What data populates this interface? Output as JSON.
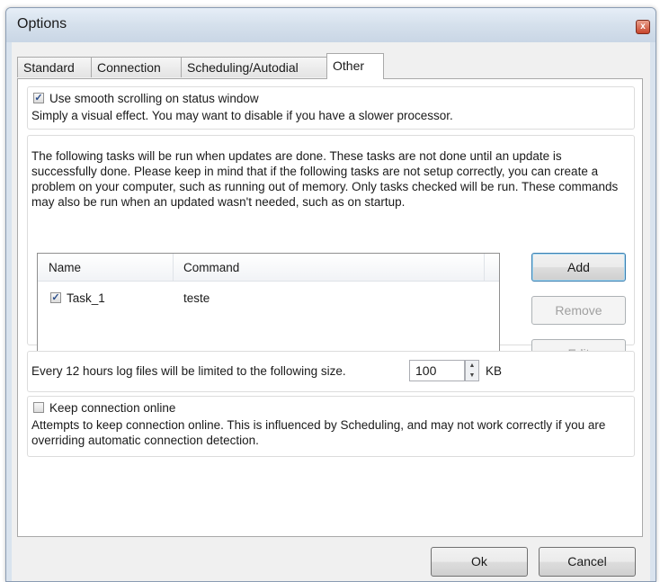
{
  "window": {
    "title": "Options",
    "close_glyph": "x"
  },
  "tabs": [
    {
      "label": "Standard"
    },
    {
      "label": "Connection"
    },
    {
      "label": "Scheduling/Autodial"
    },
    {
      "label": "Other"
    }
  ],
  "smooth_scroll": {
    "checked": true,
    "label": "Use smooth scrolling on status window",
    "description": "Simply a visual effect.  You may want to disable if you have a slower processor."
  },
  "tasks": {
    "description": "The following tasks will be run when updates are done.  These tasks are not done until an update is successfully done.  Please keep in mind that if the following tasks are not setup correctly, you can create a problem on your computer, such as running out of memory.  Only tasks checked will be run.  These commands may also be run when an updated wasn't needed, such as on startup.",
    "columns": [
      "Name",
      "Command"
    ],
    "rows": [
      {
        "checked": true,
        "name": "Task_1",
        "command": "teste"
      }
    ],
    "buttons": {
      "add": "Add",
      "remove": "Remove",
      "edit": "Edit"
    }
  },
  "log": {
    "label": "Every 12 hours log files will be limited to the following size.",
    "value": "100",
    "unit": "KB"
  },
  "keep_online": {
    "checked": false,
    "label": "Keep connection online",
    "description": "Attempts to keep connection online.  This is influenced by Scheduling, and may not work correctly if you are overriding automatic connection detection."
  },
  "footer": {
    "ok": "Ok",
    "cancel": "Cancel"
  },
  "icons": {
    "checked_glyph": "✓",
    "spin_up": "▲",
    "spin_down": "▼"
  },
  "colors": {
    "accent": "#3c7fb1",
    "close": "#c8452b"
  }
}
